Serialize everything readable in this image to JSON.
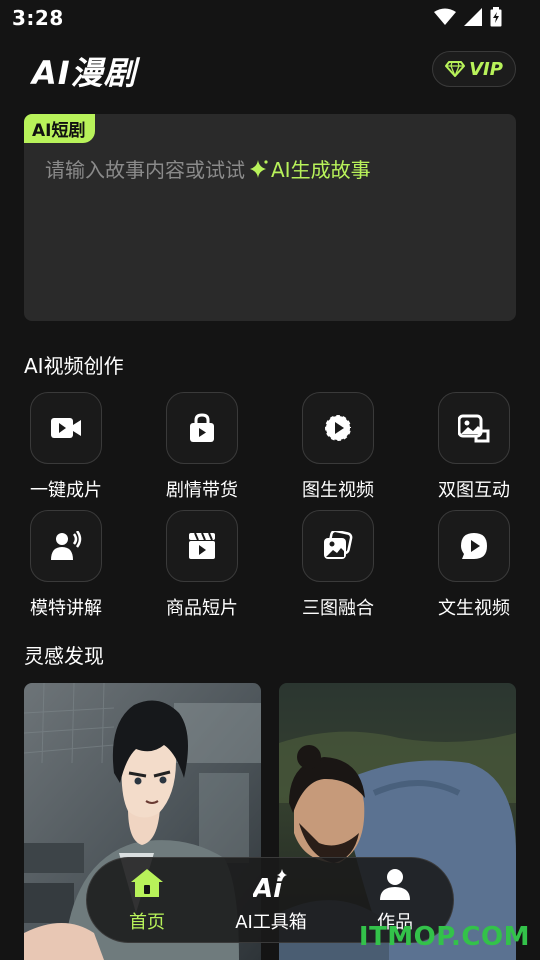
{
  "status_bar": {
    "time": "3:28"
  },
  "header": {
    "app_title": "AI漫剧",
    "vip_label": "VIP"
  },
  "prompt_card": {
    "tag": "AI短剧",
    "placeholder": "请输入故事内容或试试",
    "ai_generate_label": "AI生成故事"
  },
  "sections": {
    "video_creation_title": "AI视频创作",
    "discover_title": "灵感发现"
  },
  "tools": [
    {
      "label": "一键成片",
      "icon": "video-camera-icon"
    },
    {
      "label": "剧情带货",
      "icon": "shopping-bag-icon"
    },
    {
      "label": "图生视频",
      "icon": "image-to-video-icon"
    },
    {
      "label": "双图互动",
      "icon": "dual-image-icon"
    },
    {
      "label": "模特讲解",
      "icon": "speaker-person-icon"
    },
    {
      "label": "商品短片",
      "icon": "clapperboard-icon"
    },
    {
      "label": "三图融合",
      "icon": "image-merge-icon"
    },
    {
      "label": "文生视频",
      "icon": "text-to-video-icon"
    }
  ],
  "bottom_nav": [
    {
      "label": "首页",
      "icon": "home-icon",
      "active": true
    },
    {
      "label": "AI工具箱",
      "icon": "ai-toolbox-icon",
      "active": false
    },
    {
      "label": "作品",
      "icon": "person-icon",
      "active": false
    }
  ],
  "watermark": "ITMOP.COM",
  "colors": {
    "accent": "#b8f25a",
    "background": "#141414",
    "card": "#2a2a2a"
  }
}
